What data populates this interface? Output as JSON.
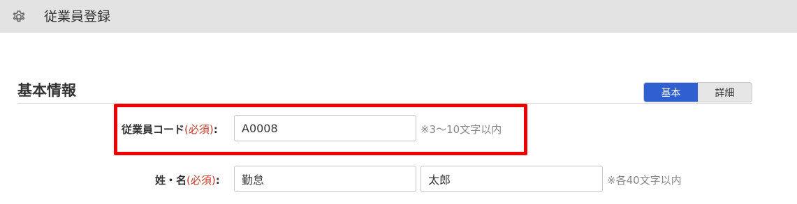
{
  "header": {
    "icon": "gear-icon",
    "title": "従業員登録"
  },
  "section": {
    "title": "基本情報",
    "toggle": {
      "options": [
        "基本",
        "詳細"
      ],
      "selected": "基本",
      "active_color": "#2f5fd0"
    }
  },
  "form": {
    "employee_code": {
      "label": "従業員コード",
      "required_text": "(必須)",
      "colon": ":",
      "value": "A0008",
      "hint": "※3〜10文字以内"
    },
    "name": {
      "label": "姓・名",
      "required_text": "(必須)",
      "colon": ":",
      "last_name_value": "勤怠",
      "first_name_value": "太郎",
      "hint": "※各40文字以内"
    }
  },
  "highlight_color": "#ee0000"
}
